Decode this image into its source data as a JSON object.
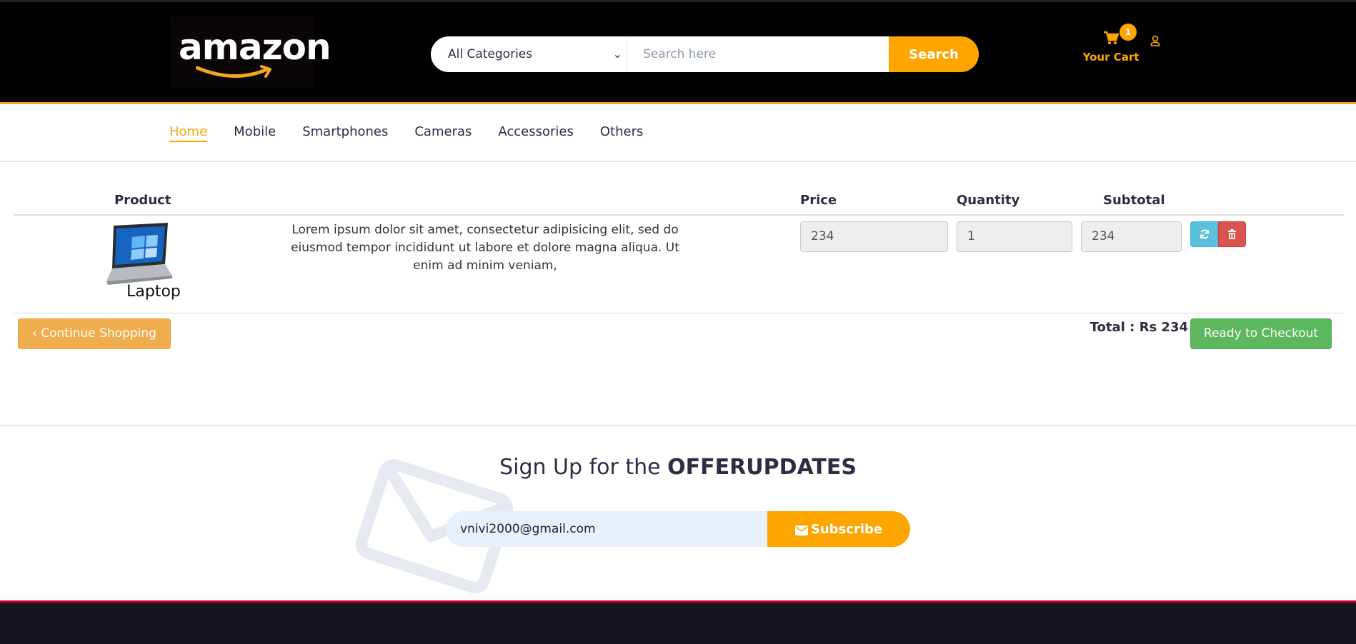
{
  "header": {
    "logo_text": "amazon",
    "category_select": "All Categories",
    "search_placeholder": "Search here",
    "search_button": "Search",
    "cart_label": "Your Cart",
    "cart_count": "1",
    "accent_color": "#ffa500"
  },
  "nav": {
    "items": [
      "Home",
      "Mobile",
      "Smartphones",
      "Cameras",
      "Accessories",
      "Others"
    ],
    "active": "Home"
  },
  "cart_table": {
    "headers": {
      "product": "Product",
      "price": "Price",
      "quantity": "Quantity",
      "subtotal": "Subtotal"
    },
    "row": {
      "name": "Laptop",
      "description": "Lorem ipsum dolor sit amet, consectetur adipisicing elit, sed do eiusmod tempor incididunt ut labore et dolore magna aliqua. Ut enim ad minim veniam,",
      "price": "234",
      "quantity": "1",
      "subtotal": "234"
    },
    "continue_button": "Continue Shopping",
    "total": "Total : Rs 234",
    "checkout_button": "Ready to Checkout"
  },
  "newsletter": {
    "title_prefix": "Sign Up for the ",
    "title_bold": "OFFERUPDATES",
    "email_value": "vnivi2000@gmail.com",
    "subscribe_button": "Subscribe"
  },
  "icons": [
    "cart-icon",
    "user-icon",
    "refresh-icon",
    "trash-icon",
    "chevron-left-icon",
    "envelope-icon",
    "chevron-down-icon"
  ]
}
